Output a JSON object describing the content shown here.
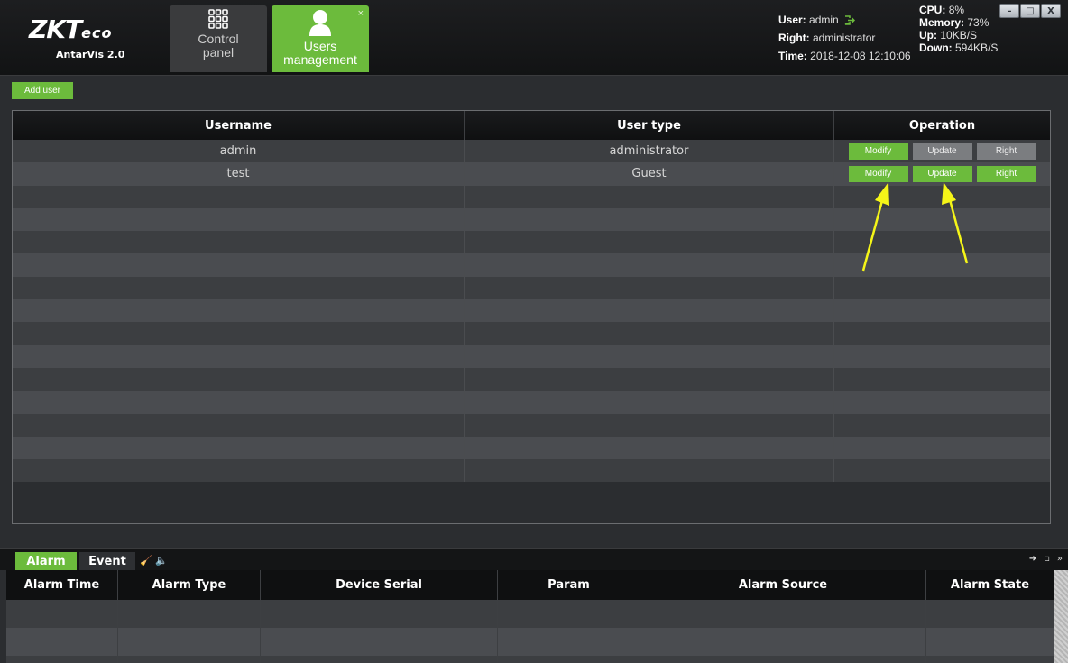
{
  "header": {
    "logo_main": "ZKT",
    "logo_eco": "eco",
    "logo_sub": "AntarVis 2.0",
    "tabs": [
      {
        "label_line1": "Control",
        "label_line2": "panel"
      },
      {
        "label_line1": "Users",
        "label_line2": "management",
        "close": "×"
      }
    ],
    "status": {
      "user_label": "User:",
      "user_value": "admin",
      "right_label": "Right:",
      "right_value": "administrator",
      "time_label": "Time:",
      "time_value": "2018-12-08 12:10:06",
      "cpu_label": "CPU:",
      "cpu_value": "8%",
      "memory_label": "Memory:",
      "memory_value": "73%",
      "up_label": "Up:",
      "up_value": "10KB/S",
      "down_label": "Down:",
      "down_value": "594KB/S"
    },
    "window_buttons": [
      "–",
      "□",
      "X"
    ]
  },
  "toolbar": {
    "add_user": "Add user"
  },
  "user_table": {
    "columns": [
      "Username",
      "User type",
      "Operation"
    ],
    "rows": [
      {
        "username": "admin",
        "type": "administrator",
        "ops": [
          "Modify",
          "Update",
          "Right"
        ]
      },
      {
        "username": "test",
        "type": "Guest",
        "ops": [
          "Modify",
          "Update",
          "Right"
        ]
      }
    ],
    "empty_rows": 13
  },
  "bottom": {
    "tabs": [
      "Alarm",
      "Event"
    ],
    "columns": [
      "Alarm Time",
      "Alarm Type",
      "Device Serial",
      "Param",
      "Alarm Source",
      "Alarm State"
    ]
  },
  "colors": {
    "accent": "#6cbb3c",
    "arrow": "#f5f518"
  }
}
